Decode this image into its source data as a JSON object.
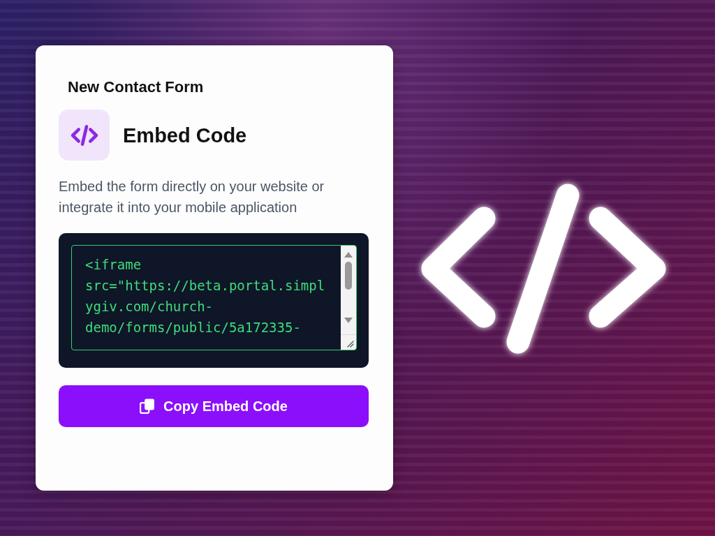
{
  "card": {
    "form_title": "New Contact Form",
    "heading": "Embed Code",
    "description": "Embed the form directly on your website or integrate it into your mobile application",
    "code_field": {
      "value": "<iframe src=\"https://beta.portal.simplygiv.com/church-demo/forms/public/5a172335-"
    },
    "copy_button": {
      "label": "Copy Embed Code"
    }
  }
}
